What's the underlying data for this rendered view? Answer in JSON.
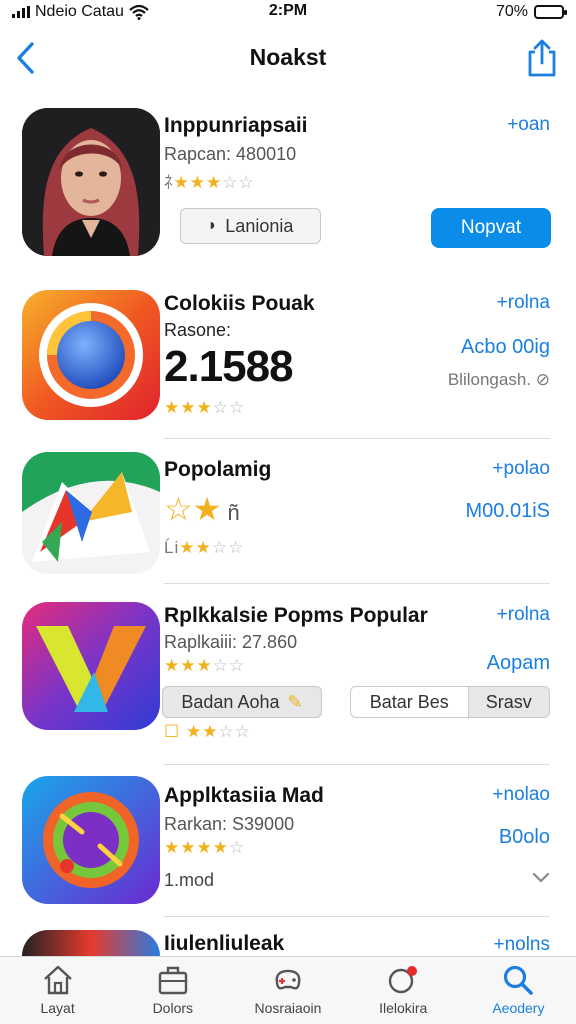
{
  "status_bar": {
    "carrier": "Ndeio Catau",
    "time": "2:PM",
    "battery": "70%",
    "battery_level": 0.7
  },
  "nav": {
    "title": "Noakst",
    "back_icon": "chevron-left-icon",
    "share_icon": "share-icon"
  },
  "apps": [
    {
      "name": "Inppunriapsaii",
      "subtitle": "Rapcan: 480010",
      "rating_prefix": "ﾈ",
      "rating": 3,
      "link": "+oan",
      "secondary_button": "Lanionia",
      "primary_button": "Nopvat"
    },
    {
      "name": "Colokiis Pouak",
      "subtitle": "Rasone:",
      "big_value": "2.1588",
      "rating": 3,
      "link": "+rolna",
      "price": "Acbo 00ig",
      "meta": "Blilongash."
    },
    {
      "name": "Popolamig",
      "rating": 2,
      "rating_prefix": "Ĺi",
      "link": "+polao",
      "price": "M00.01iS"
    },
    {
      "name": "Rplkkalsie Popms Popular",
      "subtitle": "Raplkaiii: 27.860",
      "rating": 3,
      "link": "+rolna",
      "price": "Aopam",
      "chip_left": "Badan Aoha",
      "chip_right_a": "Batar Bes",
      "chip_right_b": "Srasv",
      "rating_b": 2
    },
    {
      "name": "Applktasiia Mad",
      "subtitle": "Rarkan: S39000",
      "rating": 4,
      "link": "+nolao",
      "price": "B0olo",
      "meta": "1.mod"
    },
    {
      "name": "Iiulenliuleak",
      "link": "+nolns"
    }
  ],
  "tabs": [
    {
      "label": "Layat",
      "icon": "home-icon"
    },
    {
      "label": "Dolors",
      "icon": "briefcase-icon"
    },
    {
      "label": "Nosraiaoin",
      "icon": "gamepad-icon"
    },
    {
      "label": "Ilelokira",
      "icon": "chat-icon"
    },
    {
      "label": "Aeodery",
      "icon": "search-icon",
      "active": true
    }
  ],
  "colors": {
    "accent": "#1a7fe0",
    "primary_button": "#0c8ce9",
    "star": "#f2b01e"
  }
}
